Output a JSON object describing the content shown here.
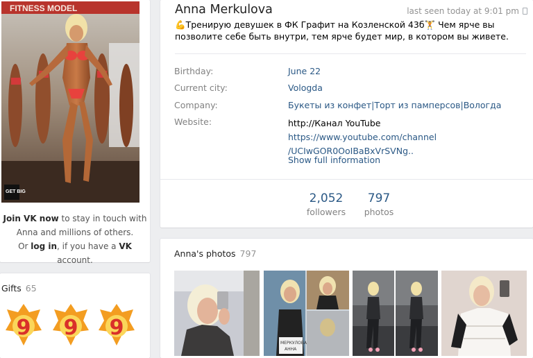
{
  "profile": {
    "name": "Anna Merkulova",
    "last_seen": "last seen today at 9:01 pm",
    "status": "💪Тренирую девушек в ФК Графит на Козленской 43б🏋 Чем ярче вы позволите себе быть внутри, тем ярче будет мир, в котором вы живете.",
    "info": {
      "birthday_label": "Birthday:",
      "birthday": "June 22",
      "city_label": "Current city:",
      "city": "Vologda",
      "company_label": "Company:",
      "company": "Букеты из конфет|Торт из памперсов|Вологда",
      "website_label": "Website:",
      "website_text": "http://Канал YouTube",
      "website_url_1": "https://www.youtube.com/channel",
      "website_url_2": "/UCIwGOR0OoIBaBxVrSVNg.."
    },
    "show_full": "Show full information",
    "counters": {
      "followers_num": "2,052",
      "followers_label": "followers",
      "photos_num": "797",
      "photos_label": "photos"
    }
  },
  "left": {
    "join_vk": "Join VK now",
    "join_rest": " to stay in touch with",
    "join_line2": "Anna and millions of others.",
    "join_or": "Or ",
    "log_in": "log in",
    "join_if": ", if you have a ",
    "vk": "VK",
    "account": " account.",
    "avatar_banner": "FITNESS MODEL",
    "avatar_logo": "GET BIG"
  },
  "gifts": {
    "title": "Gifts",
    "count": "65",
    "items": [
      "9",
      "9",
      "9"
    ]
  },
  "photos": {
    "title": "Anna's photos",
    "count": "797",
    "badge_line1": "МЕРКУЛОВА",
    "badge_line2": "АННА"
  },
  "colors": {
    "accent": "#2a5885",
    "muted": "#828282",
    "background": "#edeef0"
  }
}
